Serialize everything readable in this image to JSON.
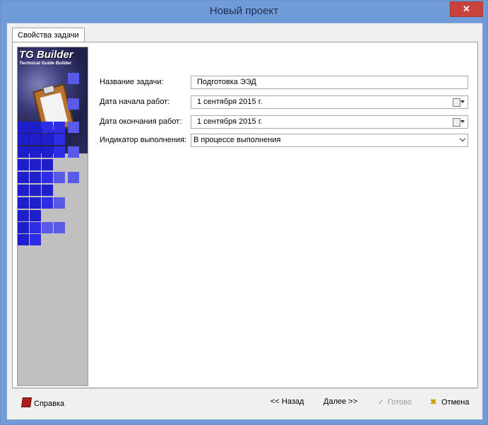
{
  "window": {
    "title": "Новый проект",
    "close_glyph": "✕"
  },
  "tabs": [
    {
      "label": "Свойства задачи"
    }
  ],
  "banner": {
    "logo": "TG Builder",
    "subtitle": "Technical Guide Builder"
  },
  "form": {
    "task_name": {
      "label": "Название задачи:",
      "value": "Подготовка ЭЭД"
    },
    "start_date": {
      "label": "Дата начала работ:",
      "value": "1 сентября 2015 г.",
      "icon": "calendar-icon"
    },
    "end_date": {
      "label": "Дата окончания работ:",
      "value": "1 сентября 2015 г.",
      "icon": "calendar-icon"
    },
    "status": {
      "label": "Индикатор выполнения:",
      "value": "В процессе выполнения",
      "icon": "chevron-down-icon"
    }
  },
  "buttons": {
    "help": {
      "label": "Справка",
      "icon": "help-book-icon"
    },
    "back": {
      "label": "<< Назад"
    },
    "next": {
      "label": "Далее >>"
    },
    "finish": {
      "label": "Готово",
      "icon": "check-icon",
      "enabled": false
    },
    "cancel": {
      "label": "Отмена",
      "icon": "cancel-x-icon"
    }
  },
  "colors": {
    "window_frame": "#6f9bd8",
    "close_button": "#c7433b",
    "banner_squares": "#1e1ecb"
  }
}
